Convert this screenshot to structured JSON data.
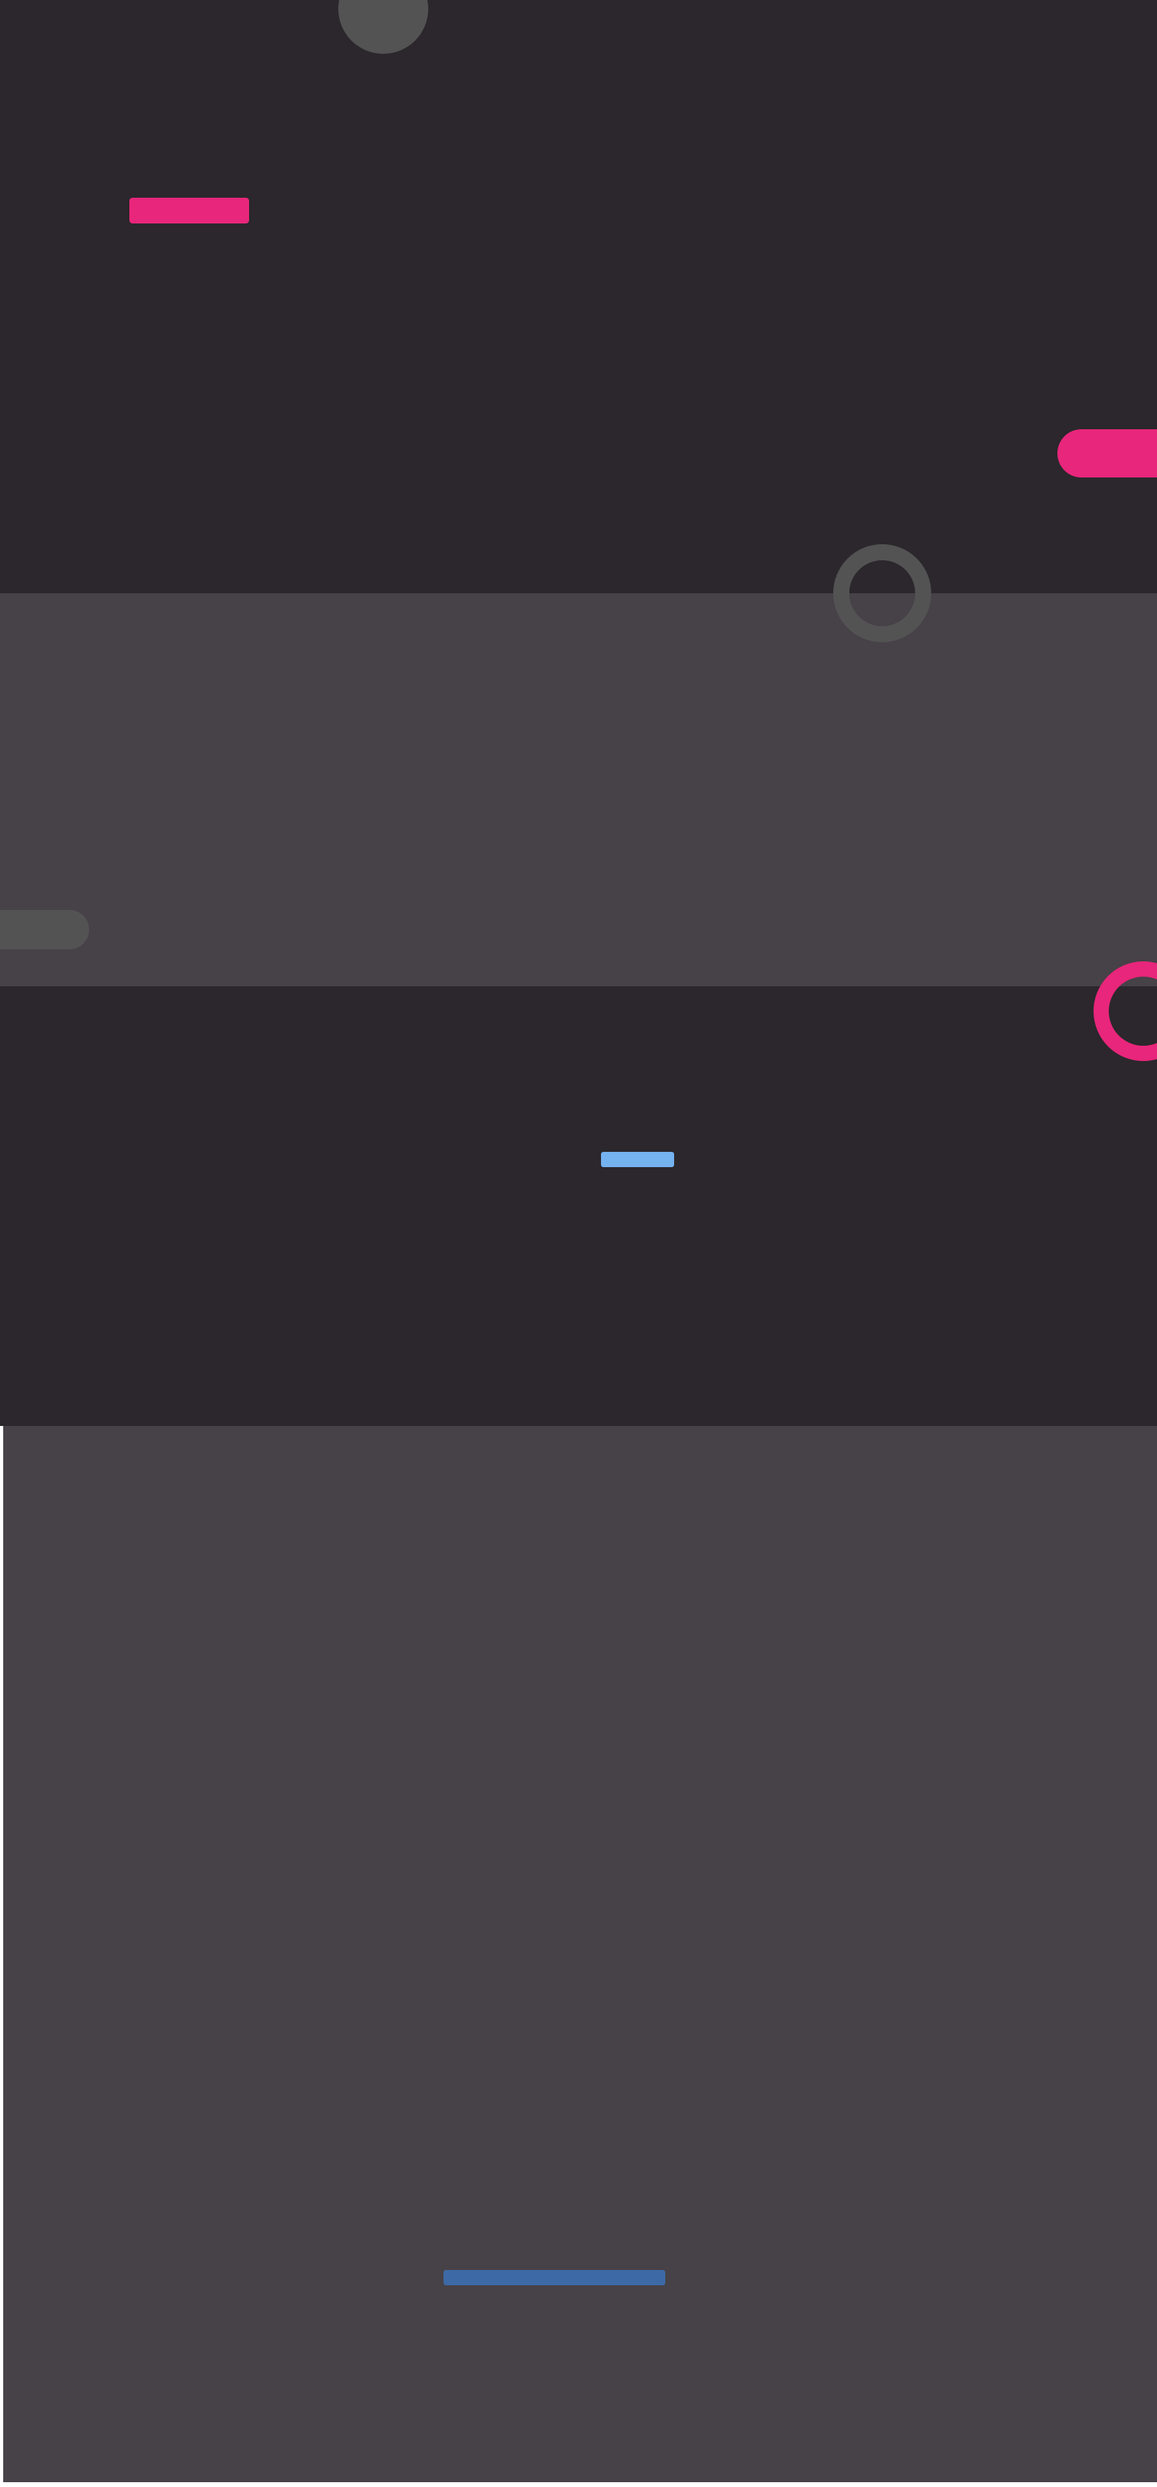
{
  "page": {
    "background_color": "#2b272c"
  },
  "sections": {
    "hero": {
      "background_color": "#2b272c"
    },
    "band": {
      "background_color": "#474148"
    },
    "feature": {
      "background_color": "#2b272c"
    },
    "footer": {
      "background_color": "#474148"
    }
  },
  "decorations": {
    "hero_top_dot": {
      "color": "#535353"
    },
    "hero_pink_bar": {
      "color": "#e8267b"
    },
    "hero_pink_pill": {
      "color": "#e8267b"
    },
    "boundary_ring_gray": {
      "color": "#535353"
    },
    "band_gray_pill": {
      "color": "#535353"
    },
    "boundary_ring_pink": {
      "color": "#e8267b"
    },
    "feature_blue_bar": {
      "color": "#75b2f0"
    },
    "footer_blue_bar": {
      "color": "#3d6aa6"
    }
  }
}
